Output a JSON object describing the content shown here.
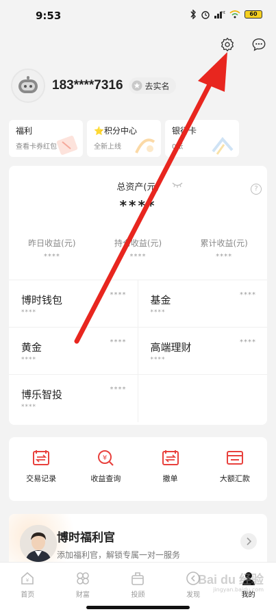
{
  "status_bar": {
    "time": "9:53",
    "battery": "60"
  },
  "header": {
    "settings_icon": "gear-icon",
    "message_icon": "chat-bubble-icon"
  },
  "profile": {
    "phone": "183****7316",
    "verify_label": "去实名"
  },
  "quick_cards": [
    {
      "title": "福利",
      "subtitle": "查看卡券红包"
    },
    {
      "title": "⭐积分中心",
      "subtitle": "全新上线"
    },
    {
      "title": "银行卡",
      "subtitle": "0张"
    }
  ],
  "assets": {
    "title": "总资产(元)",
    "total": "****",
    "stats": [
      {
        "label": "昨日收益(元)",
        "value": "****"
      },
      {
        "label": "持仓收益(元)",
        "value": "****"
      },
      {
        "label": "累计收益(元)",
        "value": "****"
      }
    ],
    "products": [
      {
        "name": "博时钱包",
        "value": "****",
        "sub": "****"
      },
      {
        "name": "基金",
        "value": "****",
        "sub": "****"
      },
      {
        "name": "黄金",
        "value": "****",
        "sub": "****"
      },
      {
        "name": "高端理财",
        "value": "****",
        "sub": "****"
      },
      {
        "name": "博乐智投",
        "value": "****",
        "sub": "****"
      }
    ]
  },
  "shortcuts": [
    {
      "label": "交易记录",
      "icon": "transaction-record-icon"
    },
    {
      "label": "收益查询",
      "icon": "income-query-icon"
    },
    {
      "label": "撤单",
      "icon": "cancel-order-icon"
    },
    {
      "label": "大额汇款",
      "icon": "large-remittance-icon"
    }
  ],
  "welfare": {
    "title": "博时福利官",
    "description": "添加福利官，解锁专属一对一服务"
  },
  "tabbar": [
    {
      "label": "首页",
      "icon": "home-icon",
      "active": false
    },
    {
      "label": "财富",
      "icon": "wealth-icon",
      "active": false
    },
    {
      "label": "投顾",
      "icon": "advisor-icon",
      "active": false
    },
    {
      "label": "发现",
      "icon": "discover-icon",
      "active": false
    },
    {
      "label": "我的",
      "icon": "profile-icon",
      "active": true
    }
  ],
  "watermark": {
    "text": "Bai du 经验",
    "sub": "jingyan.baidu.com"
  },
  "colors": {
    "accent": "#e8403c",
    "annotation": "#e8261f"
  }
}
